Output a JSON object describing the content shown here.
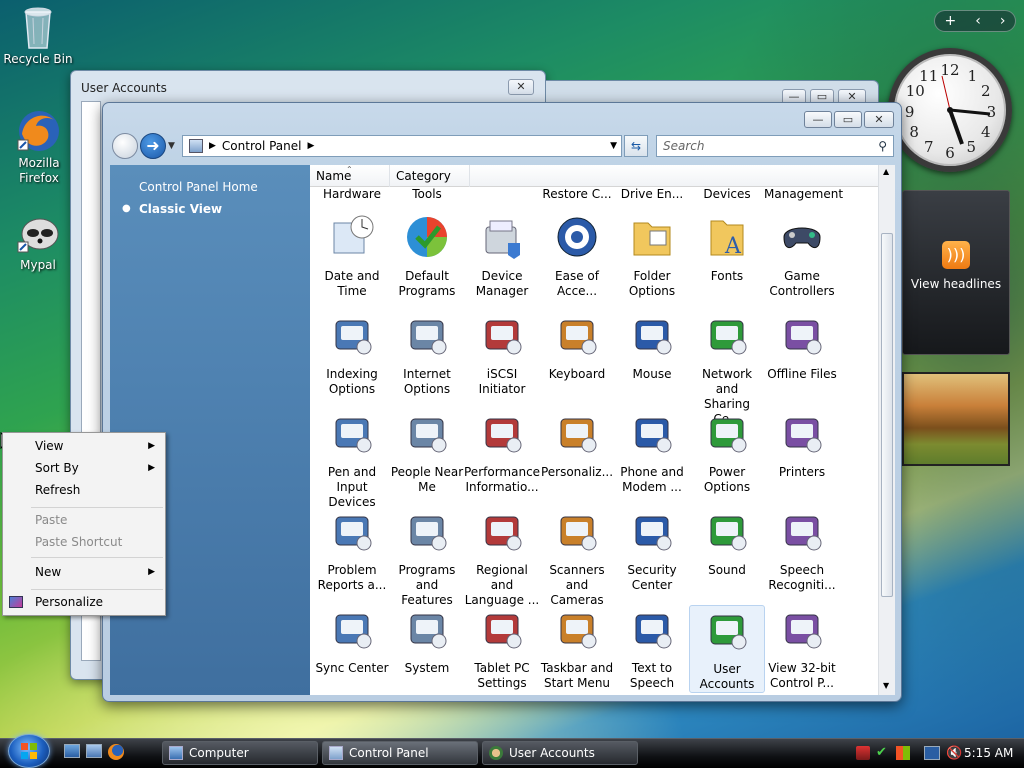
{
  "desktop": {
    "icons": [
      {
        "label": "Recycle Bin"
      },
      {
        "label": "Mozilla Firefox"
      },
      {
        "label": "Mypal"
      }
    ]
  },
  "sidebar": {
    "controls": [
      "+",
      "‹",
      "›"
    ],
    "clock_numbers": [
      "12",
      "1",
      "2",
      "3",
      "4",
      "5",
      "6",
      "7",
      "8",
      "9",
      "10",
      "11"
    ],
    "feed_label": "View headlines"
  },
  "back_window": {
    "title": "User Accounts"
  },
  "control_panel": {
    "address": "Control Panel",
    "search_placeholder": "Search",
    "left_nav": {
      "home": "Control Panel Home",
      "classic": "Classic View"
    },
    "columns": [
      "Name",
      "Category"
    ],
    "partial_row": [
      "Hardware",
      "Tools",
      "",
      "Restore C...",
      "Drive En...",
      "Devices",
      "Management"
    ],
    "items": [
      [
        "Date and",
        "Time"
      ],
      [
        "Default",
        "Programs"
      ],
      [
        "Device",
        "Manager"
      ],
      [
        "Ease of",
        "Acce..."
      ],
      [
        "Folder",
        "Options"
      ],
      [
        "Fonts",
        ""
      ],
      [
        "Game",
        "Controllers"
      ],
      [
        "Indexing",
        "Options"
      ],
      [
        "Internet",
        "Options"
      ],
      [
        "iSCSI Initiator",
        ""
      ],
      [
        "Keyboard",
        ""
      ],
      [
        "Mouse",
        ""
      ],
      [
        "Network and",
        "Sharing Ce..."
      ],
      [
        "Offline Files",
        ""
      ],
      [
        "Pen and",
        "Input Devices"
      ],
      [
        "People Near",
        "Me"
      ],
      [
        "Performance",
        "Informatio..."
      ],
      [
        "Personaliz...",
        ""
      ],
      [
        "Phone and",
        "Modem ..."
      ],
      [
        "Power",
        "Options"
      ],
      [
        "Printers",
        ""
      ],
      [
        "Problem",
        "Reports a..."
      ],
      [
        "Programs",
        "and Features"
      ],
      [
        "Regional and",
        "Language ..."
      ],
      [
        "Scanners and",
        "Cameras"
      ],
      [
        "Security",
        "Center"
      ],
      [
        "Sound",
        ""
      ],
      [
        "Speech",
        "Recogniti..."
      ],
      [
        "Sync Center",
        ""
      ],
      [
        "System",
        ""
      ],
      [
        "Tablet PC",
        "Settings"
      ],
      [
        "Taskbar and",
        "Start Menu"
      ],
      [
        "Text to",
        "Speech"
      ],
      [
        "User",
        "Accounts"
      ],
      [
        "View 32-bit",
        "Control P..."
      ]
    ]
  },
  "context_menu": {
    "view": "View",
    "sort_by": "Sort By",
    "refresh": "Refresh",
    "paste": "Paste",
    "paste_shortcut": "Paste Shortcut",
    "new": "New",
    "personalize": "Personalize"
  },
  "taskbar": {
    "buttons": [
      "Computer",
      "Control Panel",
      "User Accounts"
    ],
    "time": "5:15 AM"
  },
  "colors": {
    "nav_pane": "#4f82b1",
    "title_bar": "#bfd3e6",
    "taskbar": "#0f1114"
  }
}
